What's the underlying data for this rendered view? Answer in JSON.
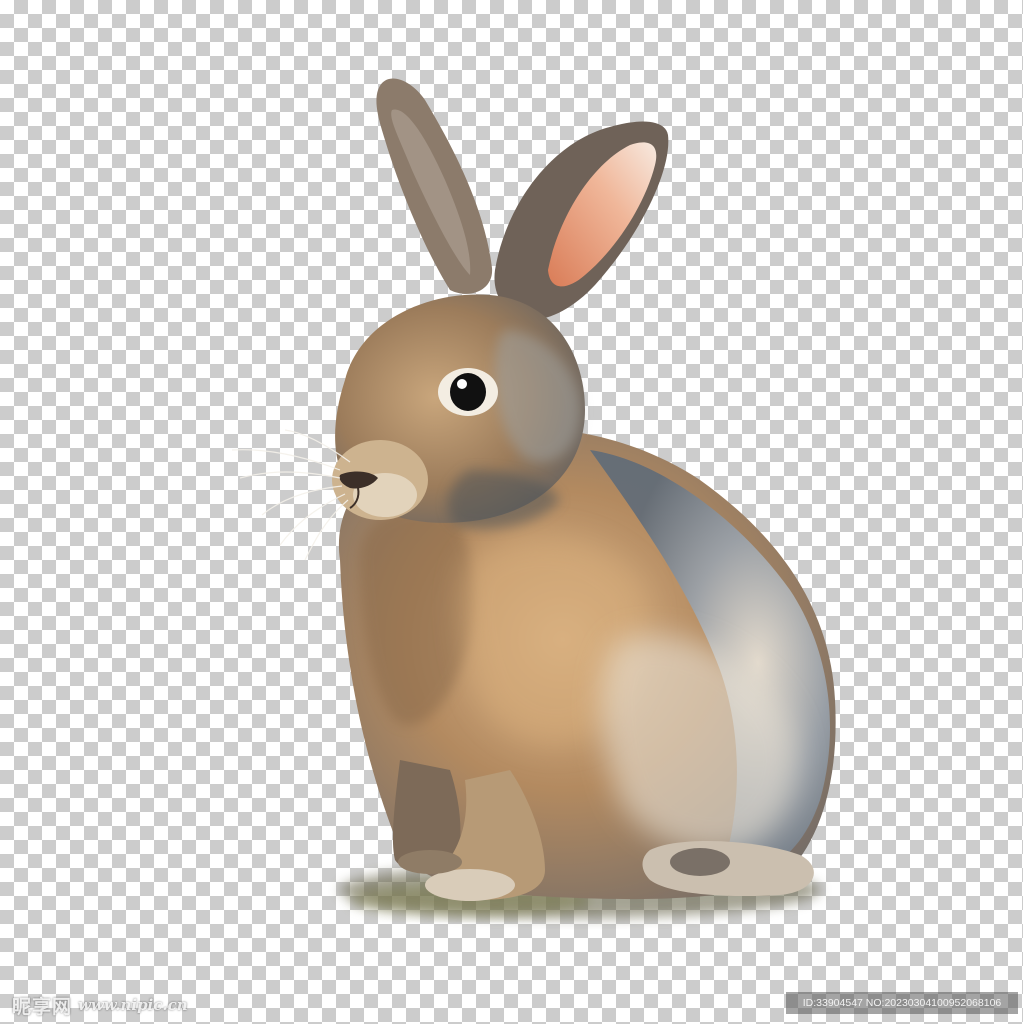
{
  "watermark": {
    "brand": "昵享网",
    "url": "www.nipic.cn"
  },
  "image_id": "ID:33904547 NO:20230304100952068106",
  "colors": {
    "checker_light": "#ffffff",
    "checker_dark": "#cccccc",
    "fur_brown": "#9a7a58",
    "fur_ochre": "#c79a67",
    "fur_grey_blue": "#7f8b96",
    "ear_inner_pink": "#e49a7a"
  }
}
